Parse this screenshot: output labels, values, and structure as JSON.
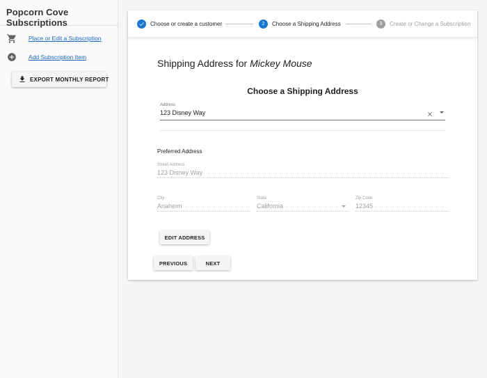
{
  "sidebar": {
    "title": "Popcorn Cove Subscriptions",
    "items": [
      {
        "label": "Place or Edit a Subscription",
        "icon": "cart-icon"
      },
      {
        "label": "Add Subscription Item",
        "icon": "add-circle-icon"
      }
    ],
    "export_label": "EXPORT MONTHLY REPORT"
  },
  "stepper": {
    "steps": [
      {
        "number": "1",
        "label": "Choose or create a customer",
        "state": "completed"
      },
      {
        "number": "2",
        "label": "Choose a Shipping Address",
        "state": "active"
      },
      {
        "number": "3",
        "label": "Create or Change a Subscription",
        "state": "inactive"
      }
    ]
  },
  "main": {
    "heading_prefix": "Shipping Address for",
    "customer_name": "Mickey Mouse",
    "subheading": "Choose a Shipping Address",
    "address_select": {
      "label": "Address",
      "value": "123 Disney Way"
    },
    "preferred_label": "Preferred Address",
    "street": {
      "label": "Street Address",
      "value": "123 Disney Way"
    },
    "city": {
      "label": "City",
      "value": "Anaheim"
    },
    "state": {
      "label": "State",
      "value": "California"
    },
    "zip": {
      "label": "Zip Code",
      "value": "12345"
    },
    "edit_address_label": "EDIT ADDRESS",
    "previous_label": "PREVIOUS",
    "next_label": "NEXT"
  },
  "colors": {
    "primary": "#1976d2",
    "link": "#1565c0",
    "inactive": "#9e9e9e"
  }
}
